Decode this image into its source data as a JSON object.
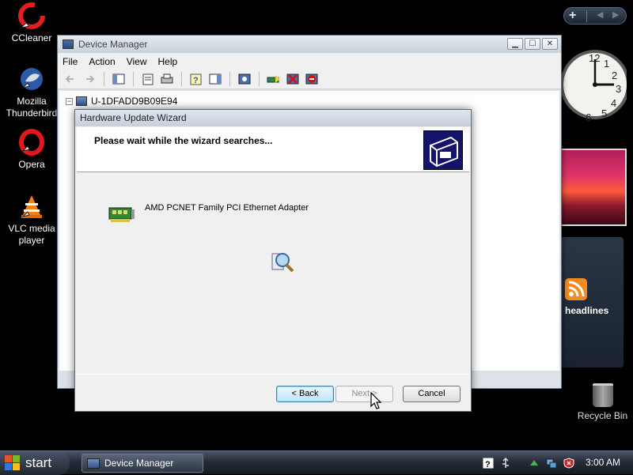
{
  "desktop": {
    "icons": [
      {
        "label": "CCleaner"
      },
      {
        "label": "Mozilla Thunderbird"
      },
      {
        "label": "Opera"
      },
      {
        "label": "VLC media player"
      }
    ],
    "recycle_bin": "Recycle Bin"
  },
  "sidebar": {
    "add_symbol": "+",
    "prev_symbol": "◀",
    "next_symbol": "▶",
    "clock_numbers": [
      "12",
      "1",
      "2",
      "3",
      "4",
      "5",
      "6"
    ],
    "feed_label": "headlines"
  },
  "device_manager": {
    "title": "Device Manager",
    "caption": {
      "minimize": "▁",
      "maximize": "☐",
      "close": "✕"
    },
    "menu": [
      "File",
      "Action",
      "View",
      "Help"
    ],
    "tree_root": "U-1DFADD9B09E94",
    "tree_expander": "−"
  },
  "wizard": {
    "title": "Hardware Update Wizard",
    "heading": "Please wait while the wizard searches...",
    "device_name": "AMD PCNET Family PCI Ethernet Adapter",
    "buttons": {
      "back": "< Back",
      "next": "Next >",
      "cancel": "Cancel"
    }
  },
  "taskbar": {
    "start_label": "start",
    "task_item": "Device Manager",
    "clock": "3:00 AM"
  },
  "colors": {
    "desktop_bg": "#000000",
    "window_chrome": "#dde2e8",
    "dialog_bg": "#f0f0f0",
    "accent_button": "#3c7fb1"
  }
}
